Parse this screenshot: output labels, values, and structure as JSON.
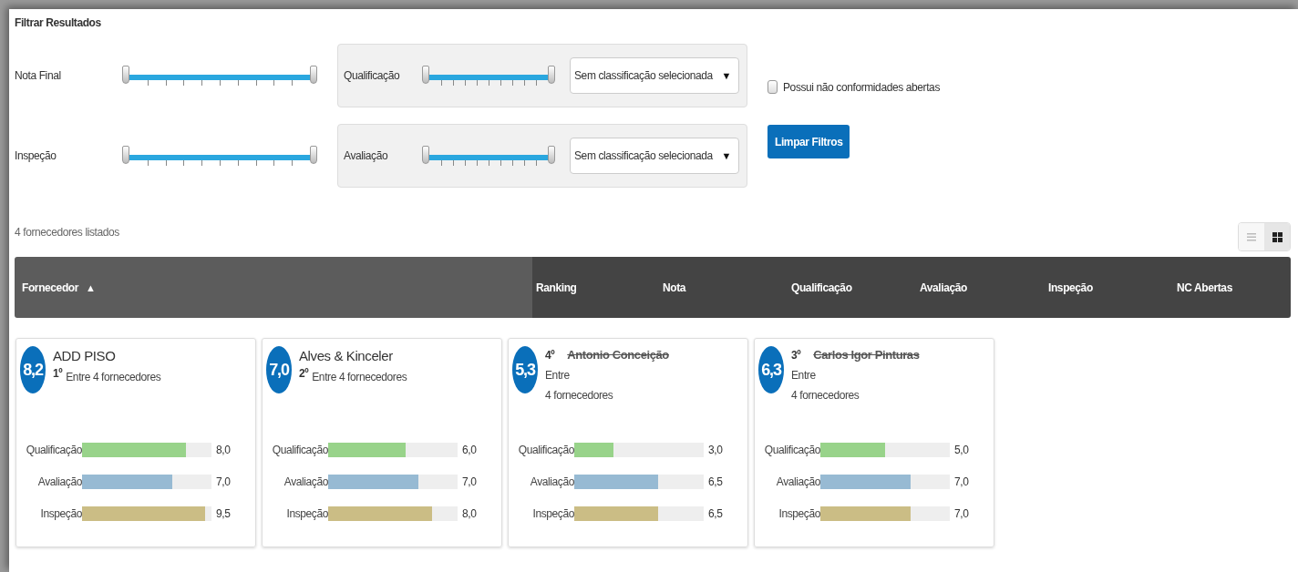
{
  "filter": {
    "title": "Filtrar Resultados",
    "sliders": [
      {
        "label": "Nota Final",
        "level": 1,
        "boxed": false
      },
      {
        "label": "Qualificação",
        "level": 1,
        "boxed": true,
        "select": "Sem classificação selecionada",
        "select_caret": "▼"
      },
      {
        "label": "Inspeção",
        "level": 1,
        "boxed": false
      },
      {
        "label": "Avaliação",
        "level": 1,
        "boxed": true,
        "select": "Sem classificação selecionada",
        "select_caret": "▼"
      }
    ],
    "checkbox": {
      "label": "Possui não conformidades abertas",
      "checked": false
    },
    "clear_button": "Limpar Filtros"
  },
  "count": "4 fornecedores listados",
  "view_toggle": [
    {
      "kind": "list",
      "selected": false
    },
    {
      "kind": "grid",
      "selected": true
    }
  ],
  "table": {
    "columns": [
      {
        "label": "Fornecedor",
        "sort_icon": "▲"
      },
      {
        "label": "Ranking"
      },
      {
        "label": "Nota"
      },
      {
        "label": "Qualificação"
      },
      {
        "label": "Avaliação"
      },
      {
        "label": "Inspeção"
      },
      {
        "label": "NC Abertas"
      }
    ]
  },
  "cards": [
    {
      "score": "8,2",
      "name": "ADD PISO",
      "rank": "1º",
      "note": "Entre 4 fornecedores",
      "struck": false,
      "metrics": [
        {
          "label": "Qualificação",
          "level": 0.8,
          "value": "8,0",
          "color": "#98d38a"
        },
        {
          "label": "Avaliação",
          "level": 0.7,
          "value": "7,0",
          "color": "#97bad3"
        },
        {
          "label": "Inspeção",
          "level": 0.95,
          "value": "9,5",
          "color": "#cbbd85"
        }
      ]
    },
    {
      "score": "7,0",
      "name": "Alves & Kinceler",
      "rank": "2º",
      "note": "Entre 4 fornecedores",
      "struck": false,
      "metrics": [
        {
          "label": "Qualificação",
          "level": 0.6,
          "value": "6,0",
          "color": "#98d38a"
        },
        {
          "label": "Avaliação",
          "level": 0.7,
          "value": "7,0",
          "color": "#97bad3"
        },
        {
          "label": "Inspeção",
          "level": 0.8,
          "value": "8,0",
          "color": "#cbbd85"
        }
      ]
    },
    {
      "score": "5,3",
      "name": "Antonio Conceição",
      "rank": "4º",
      "note": "Entre\n4 fornecedores",
      "struck": true,
      "metrics": [
        {
          "label": "Qualificação",
          "level": 0.3,
          "value": "3,0",
          "color": "#98d38a"
        },
        {
          "label": "Avaliação",
          "level": 0.65,
          "value": "6,5",
          "color": "#97bad3"
        },
        {
          "label": "Inspeção",
          "level": 0.65,
          "value": "6,5",
          "color": "#cbbd85"
        }
      ]
    },
    {
      "score": "6,3",
      "name": "Carlos Igor Pinturas",
      "rank": "3º",
      "note": "Entre\n4 fornecedores",
      "struck": true,
      "metrics": [
        {
          "label": "Qualificação",
          "level": 0.5,
          "value": "5,0",
          "color": "#98d38a"
        },
        {
          "label": "Avaliação",
          "level": 0.7,
          "value": "7,0",
          "color": "#97bad3"
        },
        {
          "label": "Inspeção",
          "level": 0.7,
          "value": "7,0",
          "color": "#cbbd85"
        }
      ]
    }
  ]
}
